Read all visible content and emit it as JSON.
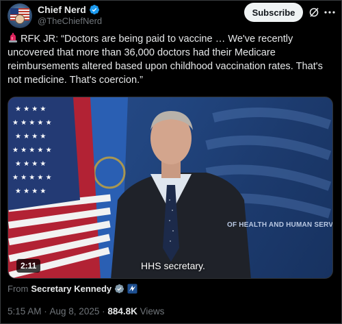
{
  "author": {
    "display_name": "Chief Nerd",
    "handle": "@TheChiefNerd"
  },
  "actions": {
    "subscribe_label": "Subscribe",
    "grok_icon": "grok-icon",
    "more_icon": "more-icon"
  },
  "tweet": {
    "siren_icon": "siren-icon",
    "text": "RFK JR: “Doctors are being paid to vaccine … We've recently uncovered that more than 36,000 doctors had their Medicare reimbursements altered based upon childhood vaccination rates. That's not medicine. That's coercion.”"
  },
  "media": {
    "backdrop_text": "OF HEALTH AND HUMAN SERVICES",
    "caption": "HHS secretary.",
    "duration": "2:11"
  },
  "from": {
    "label": "From",
    "name": "Secretary Kennedy"
  },
  "meta": {
    "time": "5:15 AM",
    "separator": " · ",
    "date": "Aug 8, 2025",
    "views_count": "884.8K",
    "views_label": " Views"
  },
  "colors": {
    "background": "#000000",
    "text_primary": "#e7e9ea",
    "text_secondary": "#71767b",
    "verified_blue": "#1d9bf0",
    "gov_gray": "#829aab"
  }
}
